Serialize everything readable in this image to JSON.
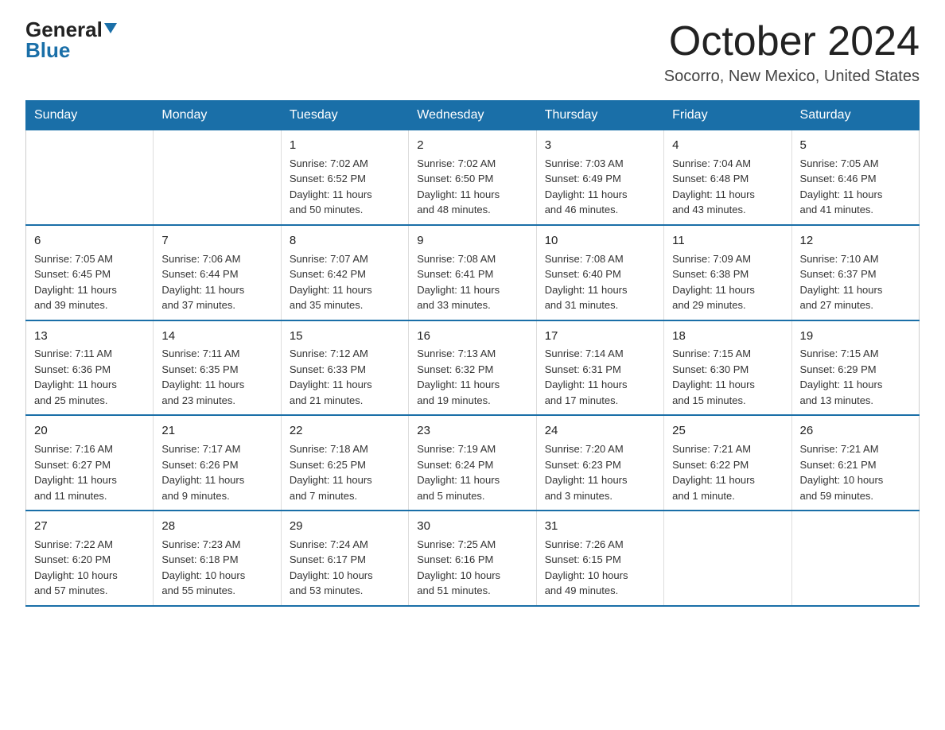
{
  "logo": {
    "general": "General",
    "blue": "Blue",
    "triangle": "▼"
  },
  "title": "October 2024",
  "location": "Socorro, New Mexico, United States",
  "days_of_week": [
    "Sunday",
    "Monday",
    "Tuesday",
    "Wednesday",
    "Thursday",
    "Friday",
    "Saturday"
  ],
  "weeks": [
    [
      {
        "day": "",
        "info": ""
      },
      {
        "day": "",
        "info": ""
      },
      {
        "day": "1",
        "info": "Sunrise: 7:02 AM\nSunset: 6:52 PM\nDaylight: 11 hours\nand 50 minutes."
      },
      {
        "day": "2",
        "info": "Sunrise: 7:02 AM\nSunset: 6:50 PM\nDaylight: 11 hours\nand 48 minutes."
      },
      {
        "day": "3",
        "info": "Sunrise: 7:03 AM\nSunset: 6:49 PM\nDaylight: 11 hours\nand 46 minutes."
      },
      {
        "day": "4",
        "info": "Sunrise: 7:04 AM\nSunset: 6:48 PM\nDaylight: 11 hours\nand 43 minutes."
      },
      {
        "day": "5",
        "info": "Sunrise: 7:05 AM\nSunset: 6:46 PM\nDaylight: 11 hours\nand 41 minutes."
      }
    ],
    [
      {
        "day": "6",
        "info": "Sunrise: 7:05 AM\nSunset: 6:45 PM\nDaylight: 11 hours\nand 39 minutes."
      },
      {
        "day": "7",
        "info": "Sunrise: 7:06 AM\nSunset: 6:44 PM\nDaylight: 11 hours\nand 37 minutes."
      },
      {
        "day": "8",
        "info": "Sunrise: 7:07 AM\nSunset: 6:42 PM\nDaylight: 11 hours\nand 35 minutes."
      },
      {
        "day": "9",
        "info": "Sunrise: 7:08 AM\nSunset: 6:41 PM\nDaylight: 11 hours\nand 33 minutes."
      },
      {
        "day": "10",
        "info": "Sunrise: 7:08 AM\nSunset: 6:40 PM\nDaylight: 11 hours\nand 31 minutes."
      },
      {
        "day": "11",
        "info": "Sunrise: 7:09 AM\nSunset: 6:38 PM\nDaylight: 11 hours\nand 29 minutes."
      },
      {
        "day": "12",
        "info": "Sunrise: 7:10 AM\nSunset: 6:37 PM\nDaylight: 11 hours\nand 27 minutes."
      }
    ],
    [
      {
        "day": "13",
        "info": "Sunrise: 7:11 AM\nSunset: 6:36 PM\nDaylight: 11 hours\nand 25 minutes."
      },
      {
        "day": "14",
        "info": "Sunrise: 7:11 AM\nSunset: 6:35 PM\nDaylight: 11 hours\nand 23 minutes."
      },
      {
        "day": "15",
        "info": "Sunrise: 7:12 AM\nSunset: 6:33 PM\nDaylight: 11 hours\nand 21 minutes."
      },
      {
        "day": "16",
        "info": "Sunrise: 7:13 AM\nSunset: 6:32 PM\nDaylight: 11 hours\nand 19 minutes."
      },
      {
        "day": "17",
        "info": "Sunrise: 7:14 AM\nSunset: 6:31 PM\nDaylight: 11 hours\nand 17 minutes."
      },
      {
        "day": "18",
        "info": "Sunrise: 7:15 AM\nSunset: 6:30 PM\nDaylight: 11 hours\nand 15 minutes."
      },
      {
        "day": "19",
        "info": "Sunrise: 7:15 AM\nSunset: 6:29 PM\nDaylight: 11 hours\nand 13 minutes."
      }
    ],
    [
      {
        "day": "20",
        "info": "Sunrise: 7:16 AM\nSunset: 6:27 PM\nDaylight: 11 hours\nand 11 minutes."
      },
      {
        "day": "21",
        "info": "Sunrise: 7:17 AM\nSunset: 6:26 PM\nDaylight: 11 hours\nand 9 minutes."
      },
      {
        "day": "22",
        "info": "Sunrise: 7:18 AM\nSunset: 6:25 PM\nDaylight: 11 hours\nand 7 minutes."
      },
      {
        "day": "23",
        "info": "Sunrise: 7:19 AM\nSunset: 6:24 PM\nDaylight: 11 hours\nand 5 minutes."
      },
      {
        "day": "24",
        "info": "Sunrise: 7:20 AM\nSunset: 6:23 PM\nDaylight: 11 hours\nand 3 minutes."
      },
      {
        "day": "25",
        "info": "Sunrise: 7:21 AM\nSunset: 6:22 PM\nDaylight: 11 hours\nand 1 minute."
      },
      {
        "day": "26",
        "info": "Sunrise: 7:21 AM\nSunset: 6:21 PM\nDaylight: 10 hours\nand 59 minutes."
      }
    ],
    [
      {
        "day": "27",
        "info": "Sunrise: 7:22 AM\nSunset: 6:20 PM\nDaylight: 10 hours\nand 57 minutes."
      },
      {
        "day": "28",
        "info": "Sunrise: 7:23 AM\nSunset: 6:18 PM\nDaylight: 10 hours\nand 55 minutes."
      },
      {
        "day": "29",
        "info": "Sunrise: 7:24 AM\nSunset: 6:17 PM\nDaylight: 10 hours\nand 53 minutes."
      },
      {
        "day": "30",
        "info": "Sunrise: 7:25 AM\nSunset: 6:16 PM\nDaylight: 10 hours\nand 51 minutes."
      },
      {
        "day": "31",
        "info": "Sunrise: 7:26 AM\nSunset: 6:15 PM\nDaylight: 10 hours\nand 49 minutes."
      },
      {
        "day": "",
        "info": ""
      },
      {
        "day": "",
        "info": ""
      }
    ]
  ]
}
